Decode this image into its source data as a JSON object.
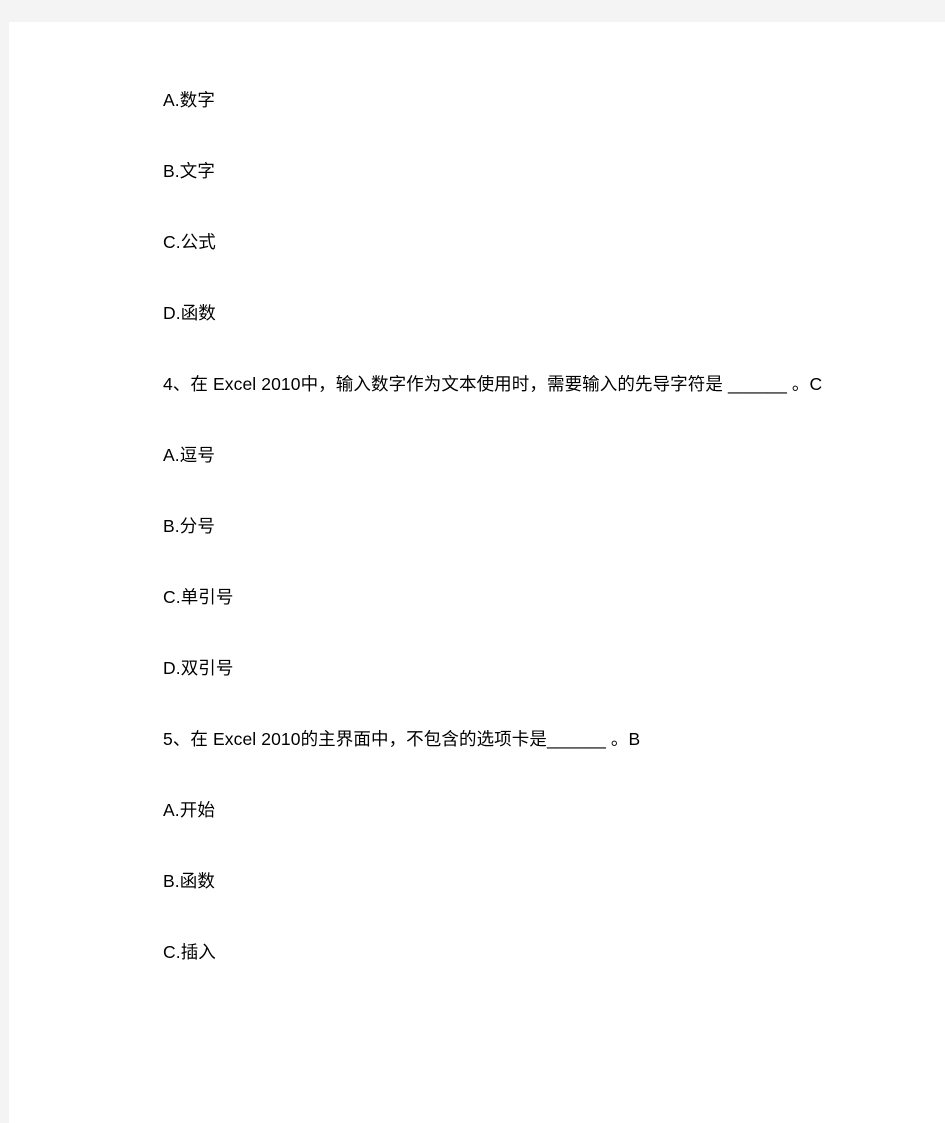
{
  "page": {
    "background_color": "#f4f4f4",
    "sheet_color": "#ffffff",
    "text_color": "#000000",
    "document_type": "exam-question-sheet",
    "subject": "Excel 2010"
  },
  "content": {
    "blocks": [
      {
        "kind": "option",
        "text": "A.数字"
      },
      {
        "kind": "option",
        "text": "B.文字"
      },
      {
        "kind": "option",
        "text": "C.公式"
      },
      {
        "kind": "option",
        "text": "D.函数"
      },
      {
        "kind": "question",
        "text": "4、在 Excel 2010中，输入数字作为文本使用时，需要输入的先导字符是 ______ 。C"
      },
      {
        "kind": "option",
        "text": "A.逗号"
      },
      {
        "kind": "option",
        "text": "B.分号"
      },
      {
        "kind": "option",
        "text": "C.单引号"
      },
      {
        "kind": "option",
        "text": "D.双引号"
      },
      {
        "kind": "question",
        "text": "5、在 Excel 2010的主界面中，不包含的选项卡是______ 。B"
      },
      {
        "kind": "option",
        "text": "A.开始"
      },
      {
        "kind": "option",
        "text": "B.函数"
      },
      {
        "kind": "option",
        "text": "C.插入"
      }
    ],
    "questions": [
      {
        "number": "4",
        "stem": "4、在 Excel 2010中，输入数字作为文本使用时，需要输入的先导字符是 ______ 。C",
        "answer": "C",
        "options": [
          "A.逗号",
          "B.分号",
          "C.单引号",
          "D.双引号"
        ]
      },
      {
        "number": "5",
        "stem": "5、在 Excel 2010的主界面中，不包含的选项卡是______ 。B",
        "answer": "B",
        "options": [
          "A.开始",
          "B.函数",
          "C.插入"
        ]
      }
    ],
    "preceding_question_options": [
      "A.数字",
      "B.文字",
      "C.公式",
      "D.函数"
    ]
  }
}
